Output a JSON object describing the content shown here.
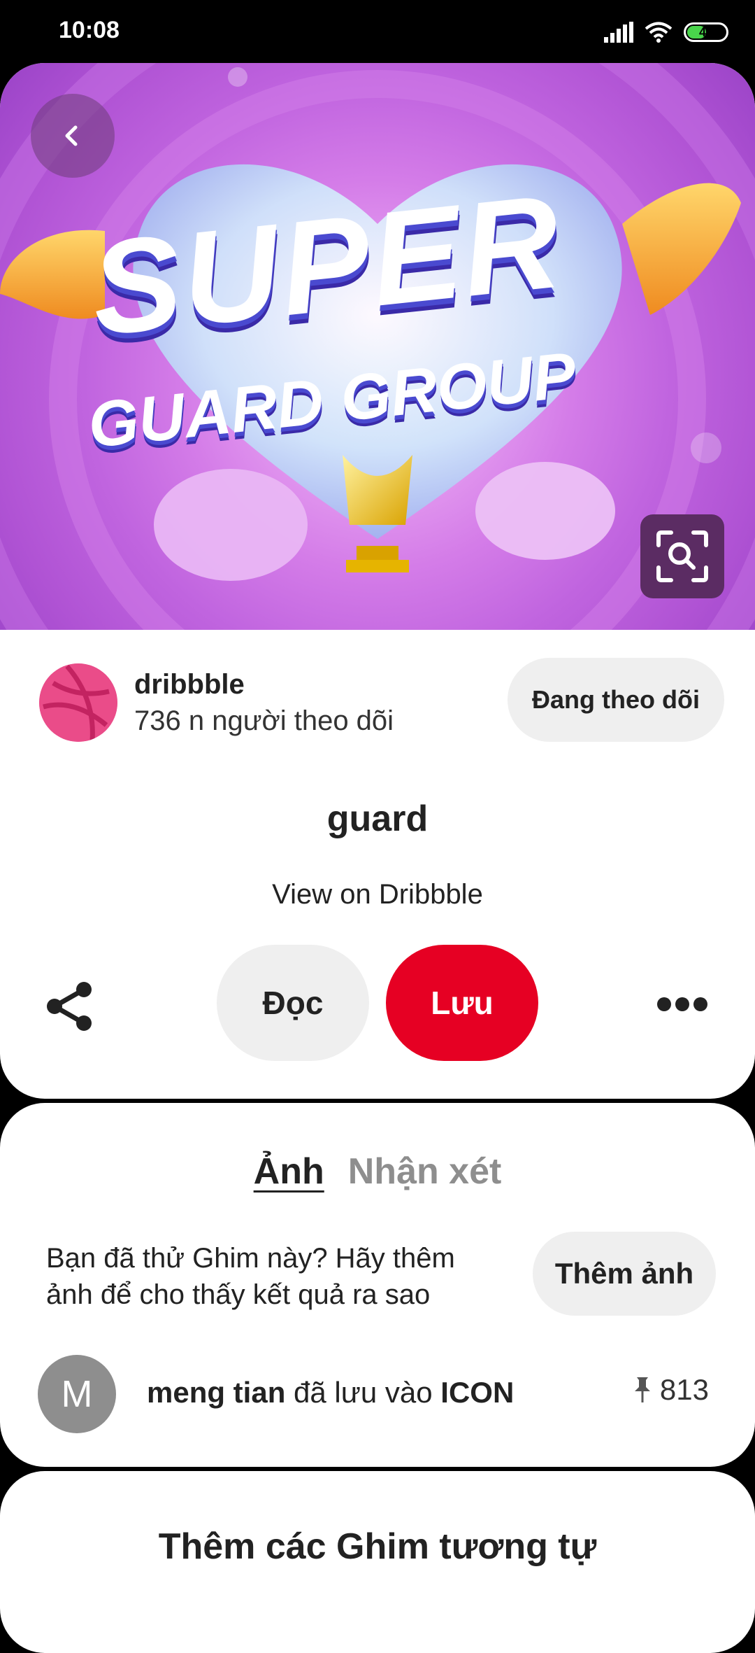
{
  "status": {
    "time": "10:08",
    "battery": "49",
    "battery_level": 0.49
  },
  "hero": {
    "headline": "SUPER",
    "subline": "GUARD GROUP"
  },
  "creator": {
    "name": "dribbble",
    "followers": "736 n người theo dõi",
    "follow_label": "Đang theo dõi"
  },
  "pin": {
    "title": "guard",
    "link_text": "View on Dribbble"
  },
  "actions": {
    "read_label": "Đọc",
    "save_label": "Lưu"
  },
  "tabs": {
    "photos": "Ảnh",
    "comments": "Nhận xét"
  },
  "tried": {
    "prompt": "Bạn đã thử Ghim này? Hãy thêm ảnh để cho thấy kết quả ra sao",
    "add_photo_label": "Thêm ảnh"
  },
  "activity": {
    "avatar_initial": "M",
    "user": "meng tian",
    "verb": "đã lưu vào",
    "board": "ICON",
    "pin_count": "813"
  },
  "more_ideas": {
    "title": "Thêm các Ghim tương tự"
  },
  "colors": {
    "save_red": "#e60023",
    "dribbble_pink": "#ea4c89",
    "pill_gray": "#efefef"
  },
  "icons": [
    "signal-icon",
    "wifi-icon",
    "battery-icon",
    "back-icon",
    "visual-search-icon",
    "share-icon",
    "more-icon",
    "pin-icon"
  ]
}
